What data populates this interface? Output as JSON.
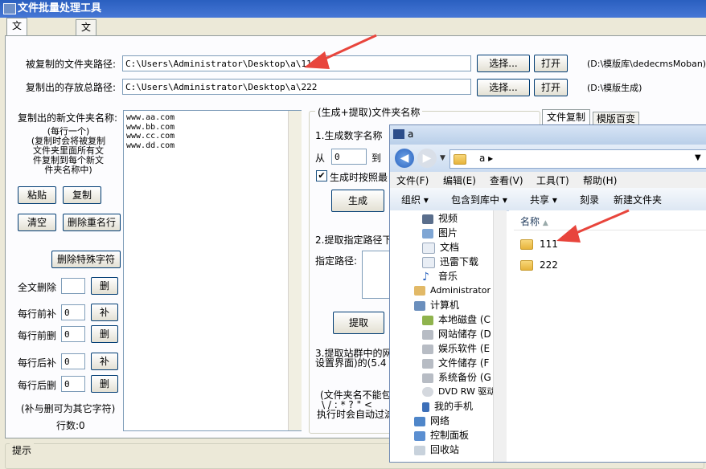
{
  "window": {
    "title": "文件批量处理工具"
  },
  "tabs": [
    {
      "label": "文件批量复制",
      "active": true
    },
    {
      "label": "文件批量修改",
      "active": false
    }
  ],
  "paths": {
    "source_label": "被复制的文件夹路径:",
    "source_value": "C:\\Users\\Administrator\\Desktop\\a\\111",
    "source_hint": "(D:\\模版库\\dedecmsMoban)",
    "dest_label": "复制出的存放总路径:",
    "dest_value": "C:\\Users\\Administrator\\Desktop\\a\\222",
    "dest_hint": "(D:\\模版生成)",
    "choose_label": "选择...",
    "open_label": "打开"
  },
  "left": {
    "new_names_label": "复制出的新文件夹名称:",
    "help_text": [
      "(每行一个)",
      "(复制时会将被复制",
      "文件夹里面所有文",
      "件复制到每个新文",
      "件夹名称中)"
    ],
    "names": [
      "www.aa.com",
      "www.bb.com",
      "www.cc.com",
      "www.dd.com"
    ],
    "paste": "粘贴",
    "copy": "复制",
    "clear": "清空",
    "dedupe": "删除重名行",
    "remove_special": "删除特殊字符",
    "delete_all_label": "全文删除",
    "delete_btn": "删",
    "prefix_add_label": "每行前补",
    "prefix_del_label": "每行前删",
    "suffix_add_label": "每行后补",
    "suffix_del_label": "每行后删",
    "add_btn": "补",
    "prefix_add_value": "0",
    "prefix_del_value": "0",
    "suffix_add_value": "0",
    "suffix_del_value": "0",
    "note": "(补与删可为其它字符)",
    "line_count": "行数:0"
  },
  "generate": {
    "group_title": "(生成+提取)文件夹名称",
    "step1": "1.生成数字名称",
    "from_label": "从",
    "from_value": "0",
    "to_label": "到",
    "checkbox_label": "生成时按照最",
    "generate_btn": "生成",
    "step2": "2.提取指定路径下",
    "path_label": "指定路径:",
    "extract_btn": "提取",
    "step3_line1": "3.提取站群中的网",
    "step3_line2": "设置界面)的(5.4",
    "footer_line1": "(文件夹名不能包",
    "footer_line2": "\\ / : * ? \" <",
    "footer_line3": "执行时会自动过滤"
  },
  "right_tabs": [
    "文件复制",
    "模版百变"
  ],
  "status": {
    "label": "提示"
  },
  "explorer": {
    "title": "a",
    "address": "a ▸",
    "menu": [
      "文件(F)",
      "编辑(E)",
      "查看(V)",
      "工具(T)",
      "帮助(H)"
    ],
    "commands": [
      "组织 ▾",
      "包含到库中 ▾",
      "共享 ▾",
      "刻录",
      "新建文件夹"
    ],
    "tree": [
      "视频",
      "图片",
      "文档",
      "迅雷下载",
      "音乐",
      "Administrator",
      "计算机",
      "本地磁盘 (C",
      "网站储存 (D",
      "娱乐软件 (E",
      "文件储存 (F",
      "系统备份 (G",
      "DVD RW 驱动",
      "我的手机",
      "网络",
      "控制面板",
      "回收站"
    ],
    "column_name": "名称",
    "files": [
      "111",
      "222"
    ]
  },
  "colors": {
    "annotation_arrow": "#e8453c"
  }
}
